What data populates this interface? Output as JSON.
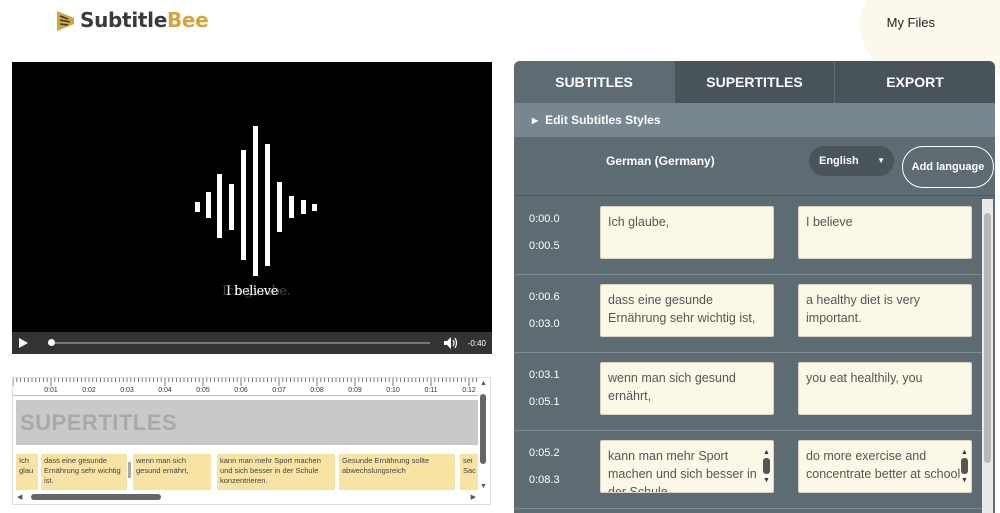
{
  "header": {
    "brand_part1": "Subtitle",
    "brand_part2": "Bee",
    "nav_my_files": "My Files"
  },
  "colors": {
    "brand_accent": "#d4a53b",
    "panel_bg": "#5f6b73",
    "tab_inactive_bg": "#48535a",
    "subtitle_block": "#f7e3a4",
    "text_box_bg": "#fcf8e8"
  },
  "video": {
    "caption_text": "I believe",
    "caption_ghost": "Ich glaube.",
    "remaining_time": "-0:40",
    "playback_fraction": 0.0,
    "play_icon": "play-icon",
    "volume_icon": "volume-icon"
  },
  "timeline": {
    "ruler_labels": [
      "0:01",
      "0:02",
      "0:03",
      "0:04",
      "0:05",
      "0:06",
      "0:07",
      "0:08",
      "0:09",
      "0:10",
      "0:11",
      "0:12"
    ],
    "supertitles_label": "SUPERTITLES",
    "subtitle_blocks": [
      {
        "text": "Ich glau"
      },
      {
        "text": "dass eine gesunde Ernährung sehr wichtig ist."
      },
      {
        "text": "wenn man sich gesund ernährt,"
      },
      {
        "text": "kann man mehr Sport machen und sich besser in der Schule konzentrieren."
      },
      {
        "text": "Gesunde Ernährung sollte abwechslungsreich"
      },
      {
        "text": "sei Sac"
      }
    ]
  },
  "panel": {
    "tabs": [
      {
        "label": "SUBTITLES",
        "active": true
      },
      {
        "label": "SUPERTITLES",
        "active": false
      },
      {
        "label": "EXPORT",
        "active": false
      }
    ],
    "edit_styles_label": "Edit Subtitles Styles",
    "source_language": "German (Germany)",
    "target_language_selected": "English",
    "add_language_label": "Add language",
    "rows": [
      {
        "start": "0:00.0",
        "end": "0:00.5",
        "source": "Ich glaube,",
        "target": "I believe"
      },
      {
        "start": "0:00.6",
        "end": "0:03.0",
        "source": "dass eine gesunde Ernährung sehr wichtig ist,",
        "target": "a healthy diet is very important."
      },
      {
        "start": "0:03.1",
        "end": "0:05.1",
        "source": "wenn man sich gesund ernährt,",
        "target": "you eat healthily, you"
      },
      {
        "start": "0:05.2",
        "end": "0:08.3",
        "source": "kann man mehr Sport machen und sich besser in der Schule",
        "target": "do more exercise and concentrate better at school"
      }
    ]
  }
}
